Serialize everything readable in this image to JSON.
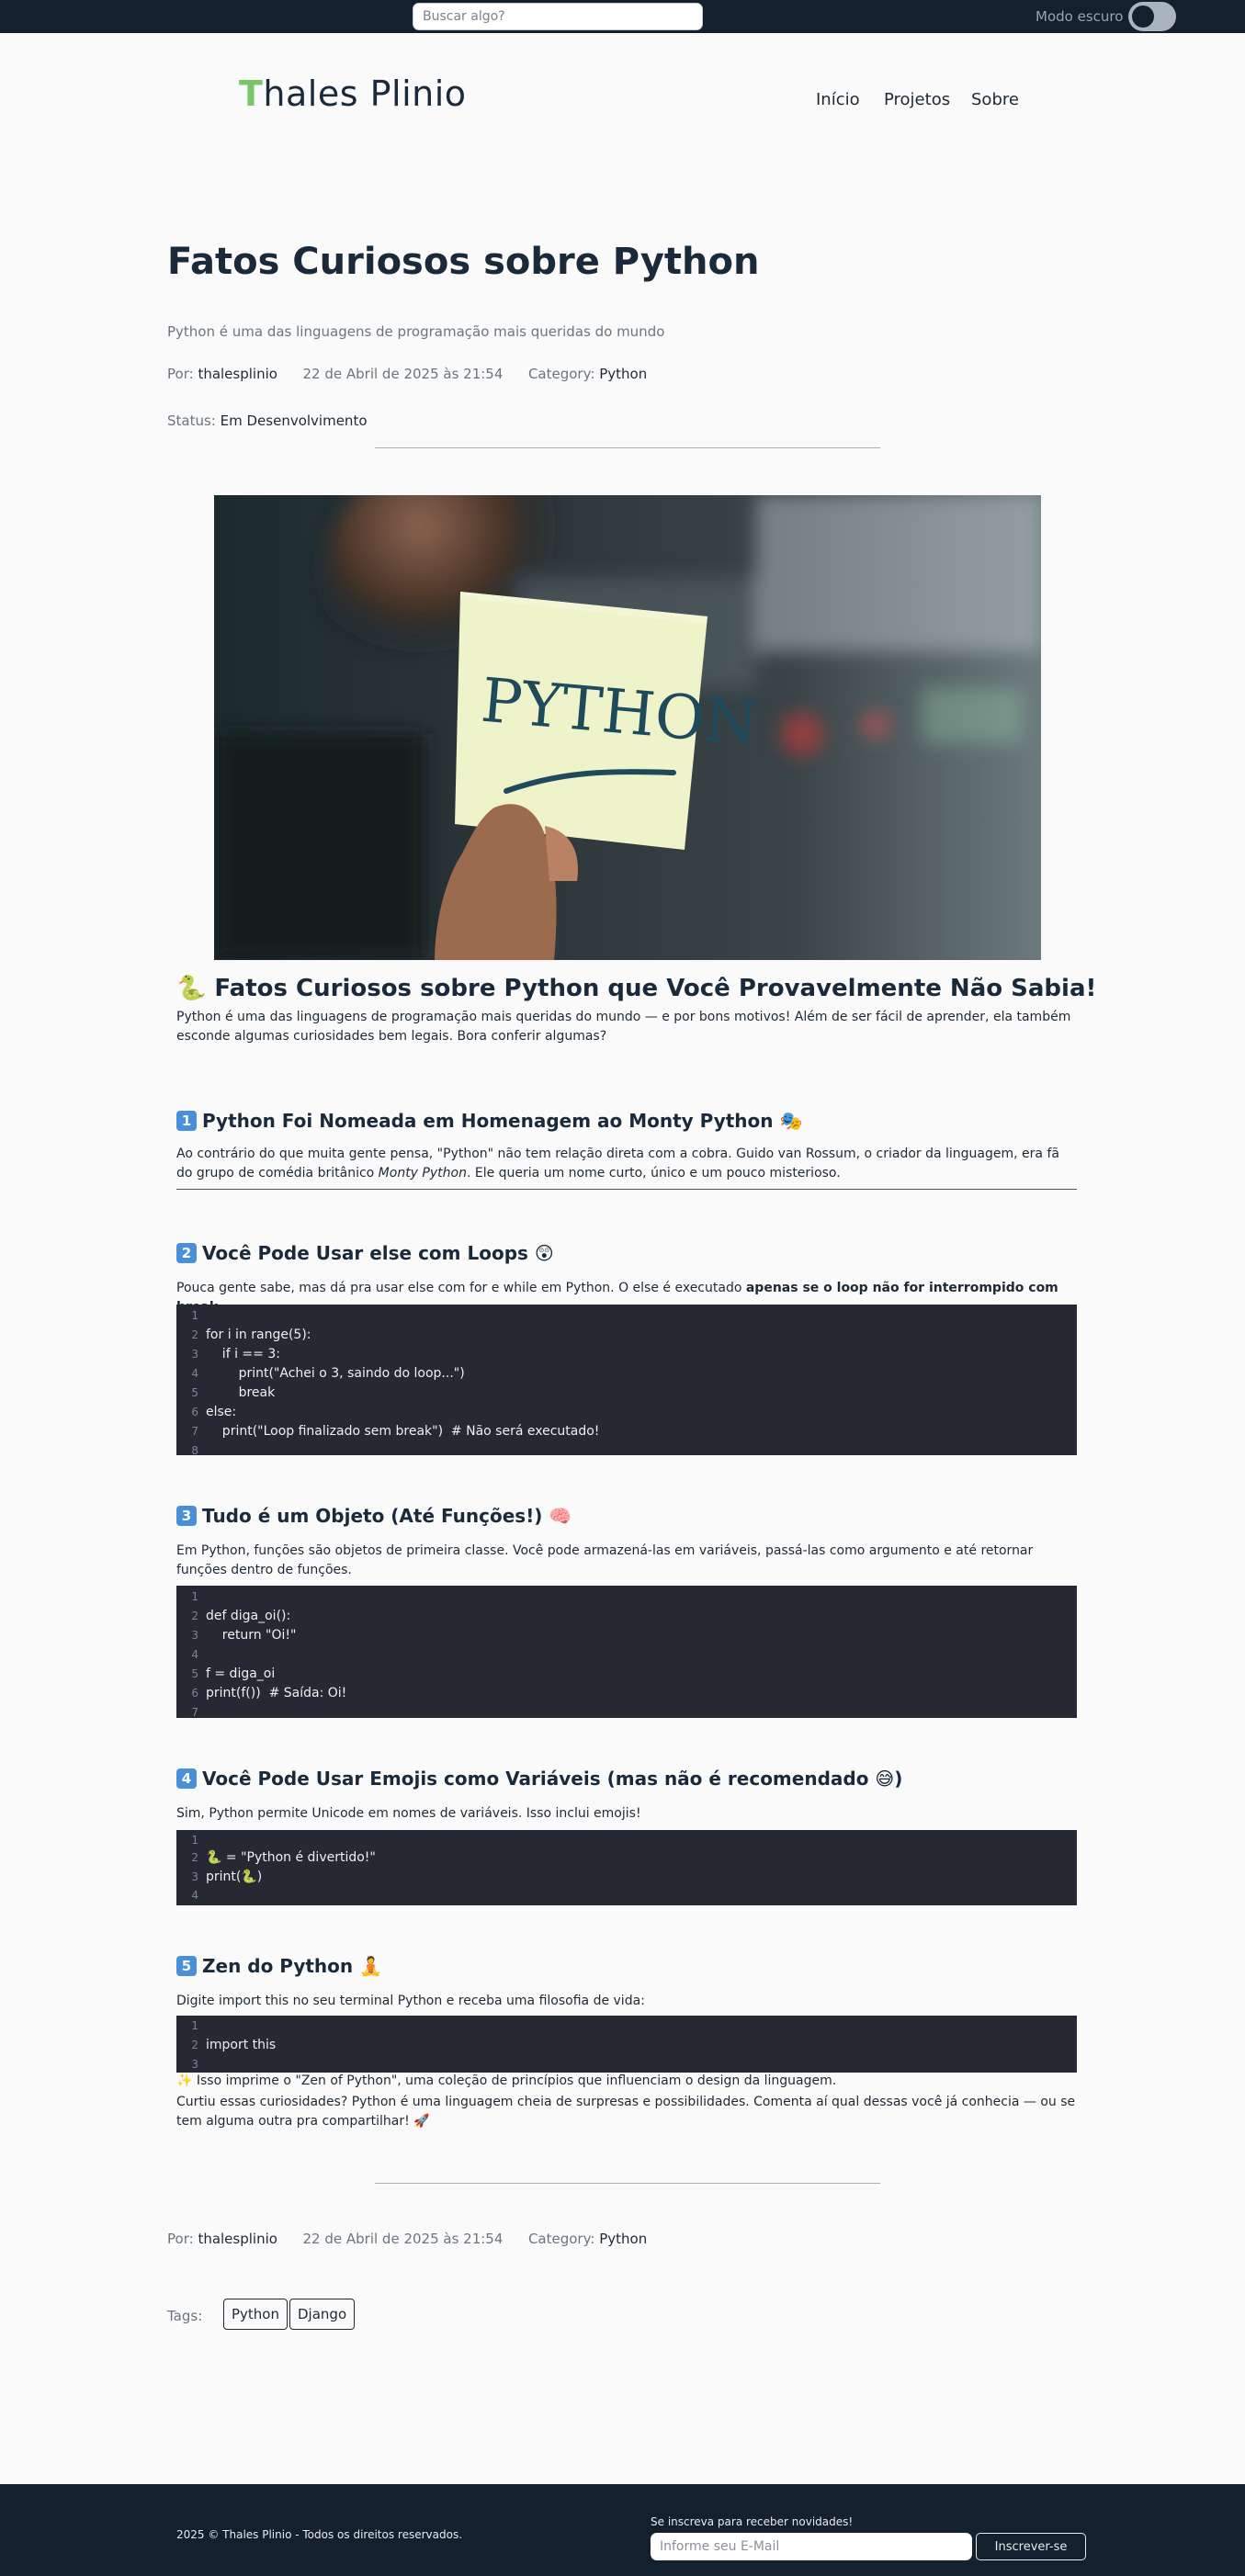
{
  "topbar": {
    "search_placeholder": "Buscar algo?",
    "dark_mode_label": "Modo escuro"
  },
  "header": {
    "logo_first": "T",
    "logo_rest": "hales Plinio",
    "nav": [
      "Início",
      "Projetos",
      "Sobre"
    ]
  },
  "post": {
    "title": "Fatos Curiosos sobre Python",
    "subtitle": "Python é uma das linguagens de programação mais queridas do mundo",
    "author_label": "Por:",
    "author": "thalesplinio",
    "date": "22 de Abril de 2025 às 21:54",
    "category_label": "Category:",
    "category": "Python",
    "status_label": "Status:",
    "status": "Em Desenvolvimento",
    "hero_text": "PYTHON"
  },
  "content": {
    "h2": "🐍 Fatos Curiosos sobre Python que Você Provavelmente Não Sabia!",
    "intro": "Python é uma das linguagens de programação mais queridas do mundo — e por bons motivos! Além de ser fácil de aprender, ela também esconde algumas curiosidades bem legais. Bora conferir algumas?",
    "s1_num": "1",
    "s1_title": "Python Foi Nomeada em Homenagem ao Monty Python 🎭",
    "s1_text_a": "Ao contrário do que muita gente pensa, \"Python\" não tem relação direta com a cobra. Guido van Rossum, o criador da linguagem, era fã do grupo de comédia britânico ",
    "s1_text_em": "Monty Python",
    "s1_text_b": ". Ele queria um nome curto, único e um pouco misterioso.",
    "s2_num": "2",
    "s2_title": "Você Pode Usar else com Loops 😲",
    "s2_text_a": "Pouca gente sabe, mas dá pra usar else com for e while em Python. O else é executado ",
    "s2_text_strong": "apenas se o loop não for interrompido com break",
    "s2_text_b": ".",
    "s2_code": [
      "",
      "for i in range(5):",
      "    if i == 3:",
      "        print(\"Achei o 3, saindo do loop...\")",
      "        break",
      "else:",
      "    print(\"Loop finalizado sem break\")  # Não será executado!",
      ""
    ],
    "s3_num": "3",
    "s3_title": "Tudo é um Objeto (Até Funções!) 🧠",
    "s3_text": "Em Python, funções são objetos de primeira classe. Você pode armazená-las em variáveis, passá-las como argumento e até retornar funções dentro de funções.",
    "s3_code": [
      "",
      "def diga_oi():",
      "    return \"Oi!\"",
      "",
      "f = diga_oi",
      "print(f())  # Saída: Oi!",
      ""
    ],
    "s4_num": "4",
    "s4_title": "Você Pode Usar Emojis como Variáveis (mas não é recomendado 😅)",
    "s4_text": "Sim, Python permite Unicode em nomes de variáveis. Isso inclui emojis!",
    "s4_code": [
      "",
      "🐍 = \"Python é divertido!\"",
      "print(🐍)",
      ""
    ],
    "s5_num": "5",
    "s5_title": "Zen do Python 🧘",
    "s5_text": "Digite import this no seu terminal Python e receba uma filosofia de vida:",
    "s5_code": [
      "",
      "import this",
      ""
    ],
    "s5_after": "✨ Isso imprime o \"Zen of Python\", uma coleção de princípios que influenciam o design da linguagem.",
    "closing": "Curtiu essas curiosidades? Python é uma linguagem cheia de surpresas e possibilidades. Comenta aí qual dessas você já conhecia — ou se tem alguma outra pra compartilhar! 🚀"
  },
  "bottom_meta": {
    "tags_label": "Tags:",
    "tags": [
      "Python",
      "Django"
    ]
  },
  "footer": {
    "copyright": "2025 © Thales Plinio - Todos os direitos reservados.",
    "newsletter_label": "Se inscreva para receber novidades!",
    "email_placeholder": "Informe seu E-Mail",
    "subscribe_label": "Inscrever-se"
  }
}
